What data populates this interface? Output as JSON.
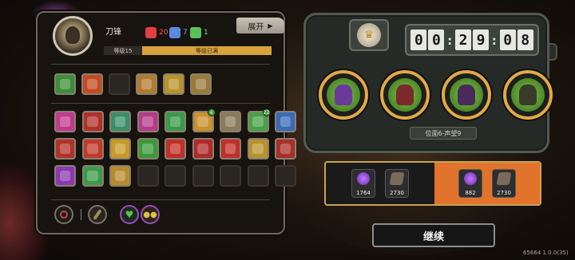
{
  "hero": {
    "name": "刀锋",
    "stats": [
      {
        "icon": "red-kill-icon",
        "value": "20",
        "color": "#e04040"
      },
      {
        "icon": "blue-item-icon",
        "value": "7",
        "color": "#5a8ae0"
      },
      {
        "icon": "green-item-icon",
        "value": "1",
        "color": "#5ac05a"
      }
    ],
    "expand_label": "展开",
    "level_label": "等级15",
    "level_status": "等级已满"
  },
  "equipment": [
    {
      "icon": "green-blade-icon",
      "color": "#3b8f3a"
    },
    {
      "icon": "flame-icon",
      "color": "#c34a22"
    },
    {
      "icon": "empty-slot",
      "color": ""
    },
    {
      "icon": "bomb-icon",
      "color": "#b07a30"
    },
    {
      "icon": "golden-armor-icon",
      "color": "#b8932d"
    },
    {
      "icon": "bronze-ring-icon",
      "color": "#9a7a3a"
    }
  ],
  "skills": [
    [
      {
        "icon": "pink-wave-icon",
        "color": "#c23a8e",
        "badge": ""
      },
      {
        "icon": "red-beast-icon",
        "color": "#b0302a",
        "badge": ""
      },
      {
        "icon": "frost-burst-icon",
        "color": "#3a8f6a",
        "badge": ""
      },
      {
        "icon": "pink-orb-icon",
        "color": "#b43a8a",
        "badge": ""
      },
      {
        "icon": "green-claw-icon",
        "color": "#3a9a4a",
        "badge": ""
      },
      {
        "icon": "gold-dome-icon",
        "color": "#c8922e",
        "badge": "4"
      },
      {
        "icon": "cat-mask-icon",
        "color": "#8a7a5a",
        "badge": ""
      },
      {
        "icon": "green-chest-icon",
        "color": "#4aa04a",
        "badge": "22"
      },
      {
        "icon": "blue-vortex-icon",
        "color": "#3a6ab8",
        "badge": ""
      }
    ],
    [
      {
        "icon": "red-axe-icon",
        "color": "#b03228",
        "badge": ""
      },
      {
        "icon": "red-slash-icon",
        "color": "#c03a2a",
        "badge": ""
      },
      {
        "icon": "gold-crown-icon",
        "color": "#c89a2a",
        "badge": ""
      },
      {
        "icon": "green-leaf-icon",
        "color": "#3a9a3a",
        "badge": ""
      },
      {
        "icon": "red-claw-icon",
        "color": "#c0302a",
        "badge": ""
      },
      {
        "icon": "red-totem-icon",
        "color": "#b02a2a",
        "badge": ""
      },
      {
        "icon": "chain-icon",
        "color": "#c0302a",
        "badge": ""
      },
      {
        "icon": "gold-wind-icon",
        "color": "#b8922e",
        "badge": ""
      },
      {
        "icon": "red-bat-icon",
        "color": "#a8302a",
        "badge": ""
      }
    ],
    [
      {
        "icon": "purple-fish-icon",
        "color": "#8a3ab0",
        "badge": ""
      },
      {
        "icon": "green-arrow-icon",
        "color": "#3a9a4a",
        "badge": ""
      },
      {
        "icon": "gold-wing-icon",
        "color": "#b88a2e",
        "badge": ""
      },
      {
        "icon": "empty-slot",
        "color": "",
        "badge": ""
      },
      {
        "icon": "empty-slot",
        "color": "",
        "badge": ""
      },
      {
        "icon": "empty-slot",
        "color": "",
        "badge": ""
      },
      {
        "icon": "empty-slot",
        "color": "",
        "badge": ""
      },
      {
        "icon": "empty-slot",
        "color": "",
        "badge": ""
      },
      {
        "icon": "empty-slot",
        "color": "",
        "badge": ""
      }
    ]
  ],
  "bottom_icons": [
    {
      "icon": "target-icon",
      "color": "#8a2a2a"
    },
    {
      "icon": "feather-icon",
      "color": "#6a5a3a"
    },
    {
      "icon": "heart-icon",
      "color": "#4ab04a"
    },
    {
      "icon": "triple-drop-icon",
      "color": "#c8a83a"
    }
  ],
  "match": {
    "timer_digits": [
      "0",
      "0",
      "2",
      "9",
      "0",
      "8"
    ],
    "opponents": [
      {
        "icon": "purple-knight-icon",
        "color": "#6a3a9a"
      },
      {
        "icon": "demon-mask-icon",
        "color": "#7a2a2a"
      },
      {
        "icon": "dark-beast-icon",
        "color": "#4a2a5a"
      },
      {
        "icon": "glasses-hero-icon",
        "color": "#3a3a2a"
      }
    ],
    "position_text": "位面6-声望9"
  },
  "rewards": {
    "left": [
      {
        "icon": "purple-gem-icon",
        "value": "1764",
        "color": "#8a3ad0"
      },
      {
        "icon": "card-icon",
        "value": "2730",
        "color": "#7a6a5a"
      }
    ],
    "right": [
      {
        "icon": "purple-gem-up-icon",
        "value": "882",
        "color": "#8a3ad0"
      },
      {
        "icon": "card-up-icon",
        "value": "2730",
        "color": "#7a6a5a"
      }
    ]
  },
  "continue_label": "继续",
  "version_text": "65664 1.0.0(35)"
}
